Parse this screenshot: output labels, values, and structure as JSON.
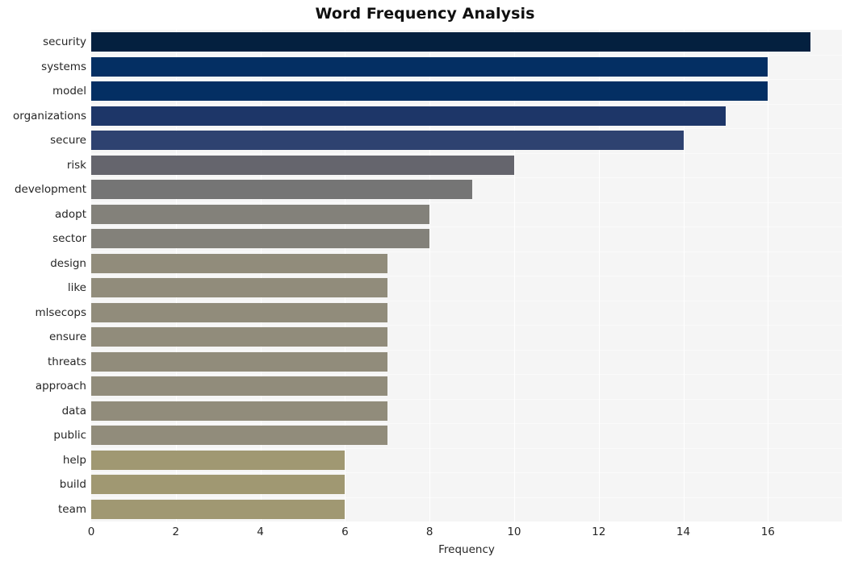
{
  "chart_data": {
    "type": "bar",
    "orientation": "horizontal",
    "title": "Word Frequency Analysis",
    "xlabel": "Frequency",
    "ylabel": "",
    "xlim": [
      0,
      17.75
    ],
    "xticks": [
      0,
      2,
      4,
      6,
      8,
      10,
      12,
      14,
      16
    ],
    "xtick_labels": [
      "0",
      "2",
      "4",
      "6",
      "8",
      "10",
      "12",
      "14",
      "16"
    ],
    "grid": true,
    "grid_axis": "x",
    "legend": null,
    "categories": [
      "security",
      "systems",
      "model",
      "organizations",
      "secure",
      "risk",
      "development",
      "adopt",
      "sector",
      "design",
      "like",
      "mlsecops",
      "ensure",
      "threats",
      "approach",
      "data",
      "public",
      "help",
      "build",
      "team"
    ],
    "values": [
      17,
      16,
      16,
      15,
      14,
      10,
      9,
      8,
      8,
      7,
      7,
      7,
      7,
      7,
      7,
      7,
      7,
      6,
      6,
      6
    ],
    "bar_colors": [
      "#04203f",
      "#042f63",
      "#042f63",
      "#1d3668",
      "#2e4270",
      "#65656d",
      "#757575",
      "#83817a",
      "#83817a",
      "#918c7b",
      "#918c7b",
      "#918c7b",
      "#918c7b",
      "#918c7b",
      "#918c7b",
      "#918c7b",
      "#918c7b",
      "#a09872",
      "#a09872",
      "#a09872"
    ],
    "plot_bgcolor": "#f5f5f5",
    "figure_bgcolor": "#ffffff",
    "gridline_color": "#ffffff"
  }
}
